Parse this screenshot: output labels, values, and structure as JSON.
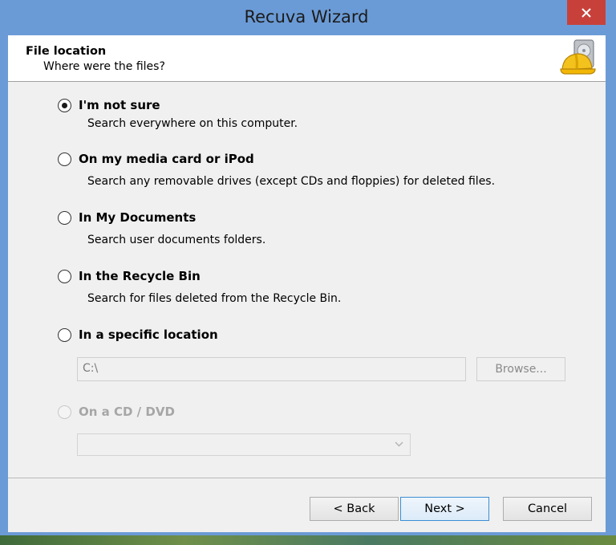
{
  "window": {
    "title": "Recuva Wizard"
  },
  "header": {
    "title": "File location",
    "subtitle": "Where were the files?",
    "icon": "hard-hat-drive-icon"
  },
  "options": [
    {
      "label": "I'm not sure",
      "description": "Search everywhere on this computer.",
      "selected": true,
      "enabled": true
    },
    {
      "label": "On my media card or iPod",
      "description": "Search any removable drives (except CDs and floppies) for deleted files.",
      "selected": false,
      "enabled": true
    },
    {
      "label": "In My Documents",
      "description": "Search user documents folders.",
      "selected": false,
      "enabled": true
    },
    {
      "label": "In the Recycle Bin",
      "description": "Search for files deleted from the Recycle Bin.",
      "selected": false,
      "enabled": true
    },
    {
      "label": "In a specific location",
      "selected": false,
      "enabled": true
    },
    {
      "label": "On a CD / DVD",
      "selected": false,
      "enabled": false
    }
  ],
  "location": {
    "value": "C:\\",
    "browse_label": "Browse..."
  },
  "cd_select": {
    "value": ""
  },
  "buttons": {
    "back": "< Back",
    "next": "Next >",
    "cancel": "Cancel"
  },
  "colors": {
    "titlebar": "#6b9bd6",
    "close": "#c7413a",
    "panel": "#f0f0f0",
    "header": "#ffffff"
  }
}
